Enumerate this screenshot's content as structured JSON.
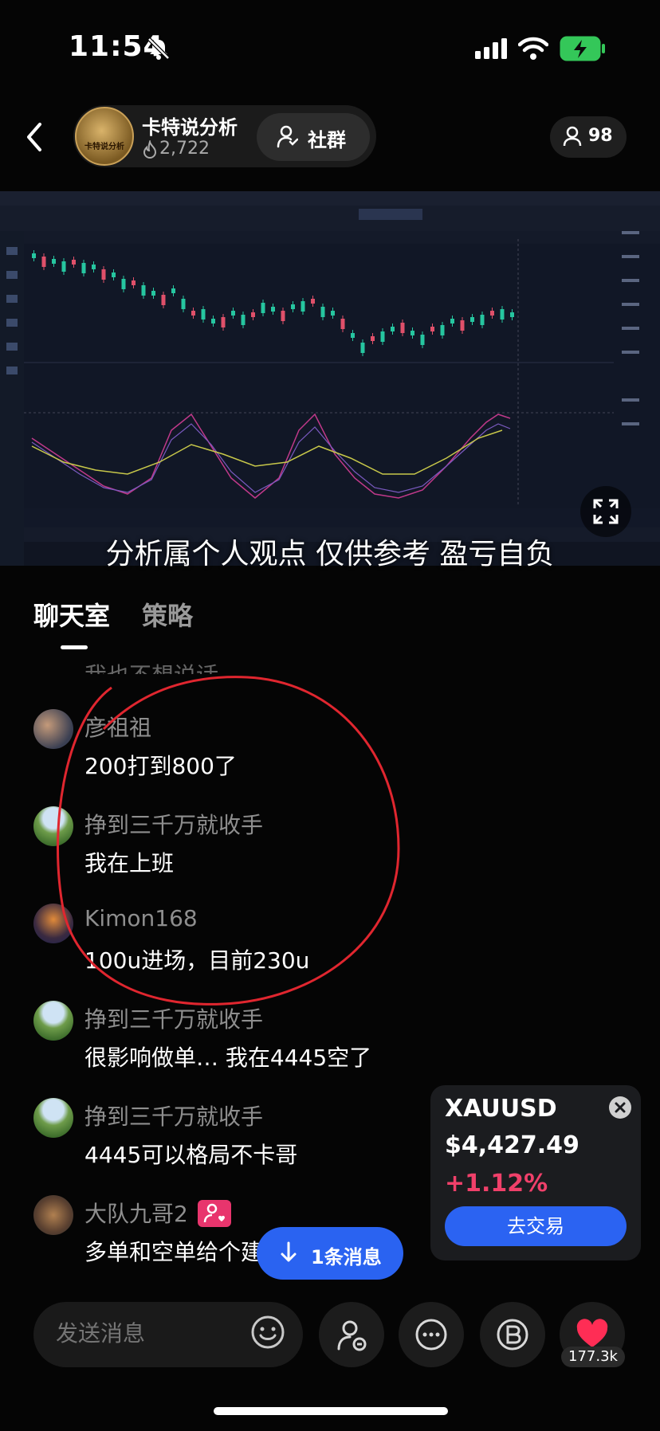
{
  "status_bar": {
    "time": "11:54"
  },
  "header": {
    "room_name": "卡特说分析",
    "avatar_text": "卡特说分析",
    "heat": "2,722",
    "group_button": "社群",
    "viewers": "98"
  },
  "video": {
    "subtitle": "分析属个人观点 仅供参考 盈亏自负"
  },
  "tabs": {
    "chat": "聊天室",
    "strategy": "策略"
  },
  "chat": {
    "partial_text": "我也不想说话",
    "messages": [
      {
        "user": "彦祖祖",
        "text": "200打到800了",
        "avatar": "people"
      },
      {
        "user": "挣到三千万就收手",
        "text": "我在上班",
        "avatar": "green"
      },
      {
        "user": "Kimon168",
        "text": "100u进场，目前230u",
        "avatar": "dark"
      },
      {
        "user": "挣到三千万就收手",
        "text": "很影响做单… 我在4445空了",
        "avatar": "green"
      },
      {
        "user": "挣到三千万就收手",
        "text": "4445可以格局不卡哥",
        "avatar": "green"
      },
      {
        "user": "大队九哥2",
        "text": "多单和空单给个建",
        "avatar": "food"
      }
    ]
  },
  "price_card": {
    "symbol": "XAUUSD",
    "price": "$4,427.49",
    "change": "+1.12%",
    "trade_button": "去交易"
  },
  "new_message_pill": {
    "label": "1条消息"
  },
  "bottom_bar": {
    "input_placeholder": "发送消息",
    "likes": "177.3k"
  },
  "colors": {
    "accent_blue": "#2b63f2",
    "up_pink": "#f0406a",
    "annotation_red": "#e0262f",
    "candle_green": "#26c6a0",
    "candle_red": "#e0506a"
  },
  "icons": [
    "bell-off-icon",
    "signal-icon",
    "wifi-icon",
    "battery-icon",
    "back-icon",
    "fire-icon",
    "group-icon",
    "user-icon",
    "fullscreen-icon",
    "close-icon",
    "arrow-down-icon",
    "emoji-icon",
    "invite-icon",
    "more-icon",
    "b-coin-icon",
    "heart-icon"
  ]
}
